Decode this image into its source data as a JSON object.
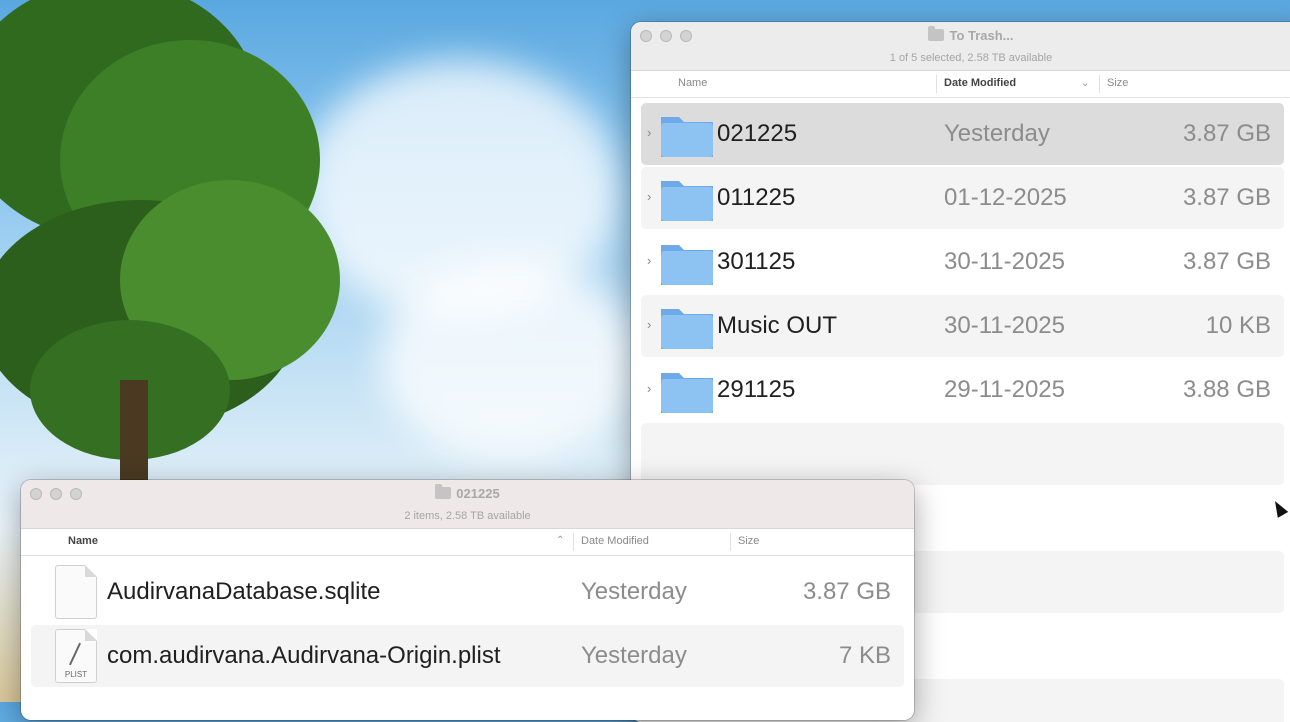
{
  "window_trash": {
    "title": "To Trash...",
    "status": "1 of 5 selected, 2.58 TB available",
    "columns": {
      "name": "Name",
      "date": "Date Modified",
      "size": "Size"
    },
    "rows": [
      {
        "name": "021225",
        "date": "Yesterday",
        "size": "3.87 GB",
        "selected": true
      },
      {
        "name": "011225",
        "date": "01-12-2025",
        "size": "3.87 GB"
      },
      {
        "name": "301125",
        "date": "30-11-2025",
        "size": "3.87 GB"
      },
      {
        "name": "Music OUT",
        "date": "30-11-2025",
        "size": "10 KB"
      },
      {
        "name": "291125",
        "date": "29-11-2025",
        "size": "3.88 GB"
      }
    ]
  },
  "window_folder": {
    "title": "021225",
    "status": "2 items, 2.58 TB available",
    "columns": {
      "name": "Name",
      "date": "Date Modified",
      "size": "Size"
    },
    "rows": [
      {
        "name": "AudirvanaDatabase.sqlite",
        "date": "Yesterday",
        "size": "3.87 GB",
        "icon": "document-icon"
      },
      {
        "name": "com.audirvana.Audirvana-Origin.plist",
        "date": "Yesterday",
        "size": "7 KB",
        "icon": "plist-document-icon",
        "icon_label": "PLIST"
      }
    ]
  },
  "colors": {
    "folder_blue": "#8cc3f3",
    "selected_row": "#dcdcdc",
    "stripe": "#f4f4f4"
  }
}
